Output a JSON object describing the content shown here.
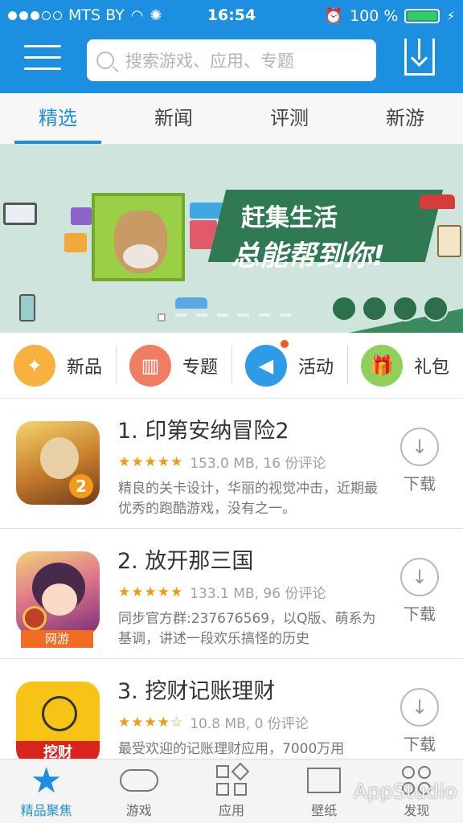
{
  "status_bar": {
    "carrier": "MTS BY",
    "time": "16:54",
    "battery": "100 %"
  },
  "header": {
    "search_placeholder": "搜索游戏、应用、专题"
  },
  "tabs": [
    {
      "label": "精选",
      "active": true
    },
    {
      "label": "新闻"
    },
    {
      "label": "评测"
    },
    {
      "label": "新游"
    }
  ],
  "banner": {
    "line1": "赶集生活",
    "line2": "总能帮到你!"
  },
  "quick": [
    {
      "label": "新品",
      "icon": "star-burst-icon",
      "color": "#f7b13f"
    },
    {
      "label": "专题",
      "icon": "bookmark-icon",
      "color": "#ef7d64"
    },
    {
      "label": "活动",
      "icon": "megaphone-icon",
      "color": "#2d9be6"
    },
    {
      "label": "礼包",
      "icon": "gift-icon",
      "color": "#8fcf5a"
    }
  ],
  "apps": [
    {
      "title": "1. 印第安纳冒险2",
      "rating": 4.5,
      "stars": "★★★★★",
      "meta": "153.0 MB, 16 份评论",
      "desc": "精良的关卡设计，华丽的视觉冲击，近期最优秀的跑酷游戏，没有之一。",
      "download": "下载"
    },
    {
      "title": "2. 放开那三国",
      "rating": 5,
      "stars": "★★★★★",
      "meta": "133.1 MB, 96 份评论",
      "desc": "同步官方群:237676569，以Q版、萌系为基调，讲述一段欢乐搞怪的历史",
      "tag": "网游",
      "download": "下载"
    },
    {
      "title": "3. 挖财记账理财",
      "rating": 4,
      "stars": "★★★★☆",
      "meta": "10.8 MB, 0 份评论",
      "desc": "最受欢迎的记账理财应用，7000万用",
      "download": "下载"
    }
  ],
  "bottom_nav": [
    {
      "label": "精品聚焦",
      "active": true
    },
    {
      "label": "游戏"
    },
    {
      "label": "应用"
    },
    {
      "label": "壁纸"
    },
    {
      "label": "发现"
    }
  ],
  "watermark": "AppStudio",
  "colors": {
    "primary": "#1d8fe0",
    "star": "#f19a1a",
    "tag": "#f26b22"
  }
}
